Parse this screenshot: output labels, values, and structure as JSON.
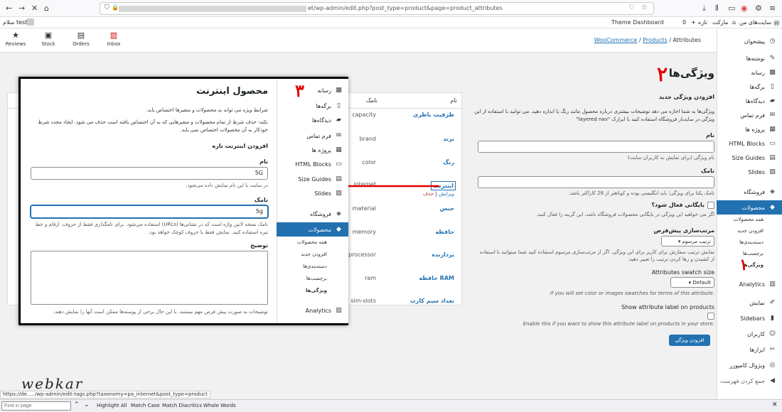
{
  "browser": {
    "url_path": "et/wp-admin/edit.php?post_type=product&page=product_attributes"
  },
  "adminbar": {
    "site_label": "سایت‌های من",
    "market_label": "مارکت",
    "new_label": "تازه",
    "comments_count": "0",
    "theme_dashboard": "Theme Dashboard",
    "greeting": "سلام test"
  },
  "topmenu": {
    "items": [
      {
        "label": "Reviews",
        "icon": "star-icon"
      },
      {
        "label": "Stock",
        "icon": "box-icon"
      },
      {
        "label": "Orders",
        "icon": "document-icon"
      },
      {
        "label": "Inbox",
        "icon": "inbox-icon"
      }
    ]
  },
  "breadcrumb": {
    "woocommerce": "WooCommerce",
    "sep": "/",
    "products": "Products",
    "current": "Attributes"
  },
  "sidebar": {
    "items": [
      {
        "label": "پیشخوان",
        "icon": "dashboard-icon"
      },
      {
        "label": "نوشته‌ها",
        "icon": "pin-icon"
      },
      {
        "label": "رسانه",
        "icon": "media-icon"
      },
      {
        "label": "برگه‌ها",
        "icon": "page-icon"
      },
      {
        "label": "دیدگاه‌ها",
        "icon": "comment-icon"
      },
      {
        "label": "فرم تماس",
        "icon": "mail-icon"
      },
      {
        "label": "پروژه ها",
        "icon": "portfolio-icon"
      },
      {
        "label": "HTML Blocks",
        "icon": "block-icon"
      },
      {
        "label": "Size Guides",
        "icon": "ruler-icon"
      },
      {
        "label": "Slides",
        "icon": "slides-icon"
      },
      {
        "label": "فروشگاه",
        "icon": "woo-icon"
      },
      {
        "label": "محصولات",
        "icon": "product-icon"
      }
    ],
    "subitems": [
      "همه محصولات",
      "افزودن جدید",
      "دسته‌بندی‌ها",
      "برچسب‌ها",
      "ویژگی‌ها"
    ],
    "lower": [
      {
        "label": "Analytics",
        "icon": "chart-icon"
      },
      {
        "label": "نمایش",
        "icon": "brush-icon"
      },
      {
        "label": "Sidebars",
        "icon": "sidebar-icon"
      },
      {
        "label": "کاربران",
        "icon": "user-icon"
      },
      {
        "label": "ابزارها",
        "icon": "wrench-icon"
      },
      {
        "label": "ویژوال کامپوزر",
        "icon": "composer-icon"
      },
      {
        "label": "جمع کردن فهرست",
        "icon": "collapse-icon"
      }
    ]
  },
  "form": {
    "page_title": "ویژگی‌ها",
    "section_title": "افزودن ویژگی جدید",
    "intro": "ویژگی‌ها به شما اجازه می دهد توضیحات بیشتری درباره محصول مانند رنگ یا اندازه دهید. می توانید با استفاده از این ویژگی در سایدبار فروشگاه استفاده کنید با ابزارک \"layered nav\"",
    "name_label": "نام",
    "name_help": "نام ویژگی (برای نمایش به کاربران سایت)",
    "slug_label": "نامک",
    "slug_help": "نامک یکتا برای ویژگی؛ باید انگلیسی بوده و کوتاهتر از 28 کاراکتر باشد.",
    "archive_label": "بایگانی فعال شود؟",
    "archive_help": "اگر می خواهید این ویژگی در بایگانی محصولات فروشگاه باشد، این گزینه را فعال کنید.",
    "sort_label": "مرتب‌سازی پیش‌فرض",
    "sort_value": "ترتیب مرسوم",
    "sort_help": "نمایش ترتیب سفارش برای کاربر برای این ویژگی. اگر از مرتب‌سازی مرسوم استفاده کنید شما میتوانید با استفاده از کشیدن و رها کردن ترتیب را تغییر دهید.",
    "swatch_label": "Attributes swatch size",
    "swatch_value": "Default",
    "swatch_help": "If you will set color or images swatches for terms of this attribute.",
    "showlabel_label": "Show attribute label on products",
    "showlabel_help": "Enable this if you want to show this attribute label on products in your store.",
    "submit": "افزودن ویژگی"
  },
  "table": {
    "col_name": "نام",
    "col_slug": "نامک",
    "rows": [
      {
        "name": "ظرفیت باطری",
        "slug": "capacity"
      },
      {
        "name": "برند",
        "slug": "brand"
      },
      {
        "name": "رنگ",
        "slug": "color"
      },
      {
        "name": "اینترنت",
        "slug": "internet"
      },
      {
        "name": "جنس",
        "slug": "material"
      },
      {
        "name": "حافظه",
        "slug": "memory"
      },
      {
        "name": "پردازنده",
        "slug": "processor"
      },
      {
        "name": "حافظه RAM",
        "slug": "ram"
      },
      {
        "name": "تعداد سیم کارت",
        "slug": "sim-slots"
      }
    ],
    "row_edit": "ویرایش",
    "row_delete": "حذف"
  },
  "popup": {
    "title": "محصول اینترنت",
    "desc1": "شرایط ویژه می تواند به محصولات و متغیرها اختصاص یابد.",
    "desc2": "نکته: حذف شرط از تمام محصولات و متغیرهایی که به آن اختصاص یافته است حذف می شود. ایجاد مجدد شرط خودکار به آن محصولات اختصاص نمی یابد.",
    "add_title": "افزودن اینترنت تازه",
    "name_label": "نام",
    "name_value": "5G",
    "name_help": "در سایت با این نام نمایش داده می‌شود.",
    "slug_label": "نامک",
    "slug_value": "5g",
    "slug_help": "نامک نسخه لاتین واژه است که در نشانی‌ها (URLs) استفاده می‌شود. برای نامگذاری فقط از حروف، ارقام و خط تیره استفاده کنید. نمایش فقط با حروف کوچک خواهد بود.",
    "desc_label": "توضیح",
    "desc_help": "توضیحات به صورت پیش فرض مهم نیستند، با این حال برخی از پوسته‌ها ممکن است آنها را نمایش دهند.",
    "side_items": [
      {
        "label": "رسانه",
        "icon": "media-icon"
      },
      {
        "label": "برگه‌ها",
        "icon": "page-icon"
      },
      {
        "label": "دیدگاه‌ها",
        "icon": "comment-icon"
      },
      {
        "label": "فرم تماس",
        "icon": "mail-icon"
      },
      {
        "label": "پروژه ها",
        "icon": "portfolio-icon"
      },
      {
        "label": "HTML Blocks",
        "icon": "block-icon"
      },
      {
        "label": "Size Guides",
        "icon": "ruler-icon"
      },
      {
        "label": "Slides",
        "icon": "slides-icon"
      },
      {
        "label": "فروشگاه",
        "icon": "woo-icon"
      },
      {
        "label": "محصولات",
        "icon": "product-icon"
      }
    ],
    "side_subitems": [
      "همه محصولات",
      "افزودن جدید",
      "دسته‌بندی‌ها",
      "برچسب‌ها",
      "ویژگی‌ها"
    ],
    "side_analytics": "Analytics"
  },
  "annotations": {
    "one": "١",
    "two": "٢",
    "three": "٣"
  },
  "logo": {
    "text": "webkar"
  },
  "status": {
    "url": "https://de...../wp-admin/edit-tags.php?taxonomy=pa_internet&post_type=product"
  },
  "findbar": {
    "placeholder": "Find in page",
    "highlight": "Highlight All",
    "match_case": "Match Case",
    "diacritics": "Match Diacritics",
    "whole": "Whole Words"
  },
  "colors": {
    "accent": "#2271b1",
    "annotation": "#e60000"
  }
}
